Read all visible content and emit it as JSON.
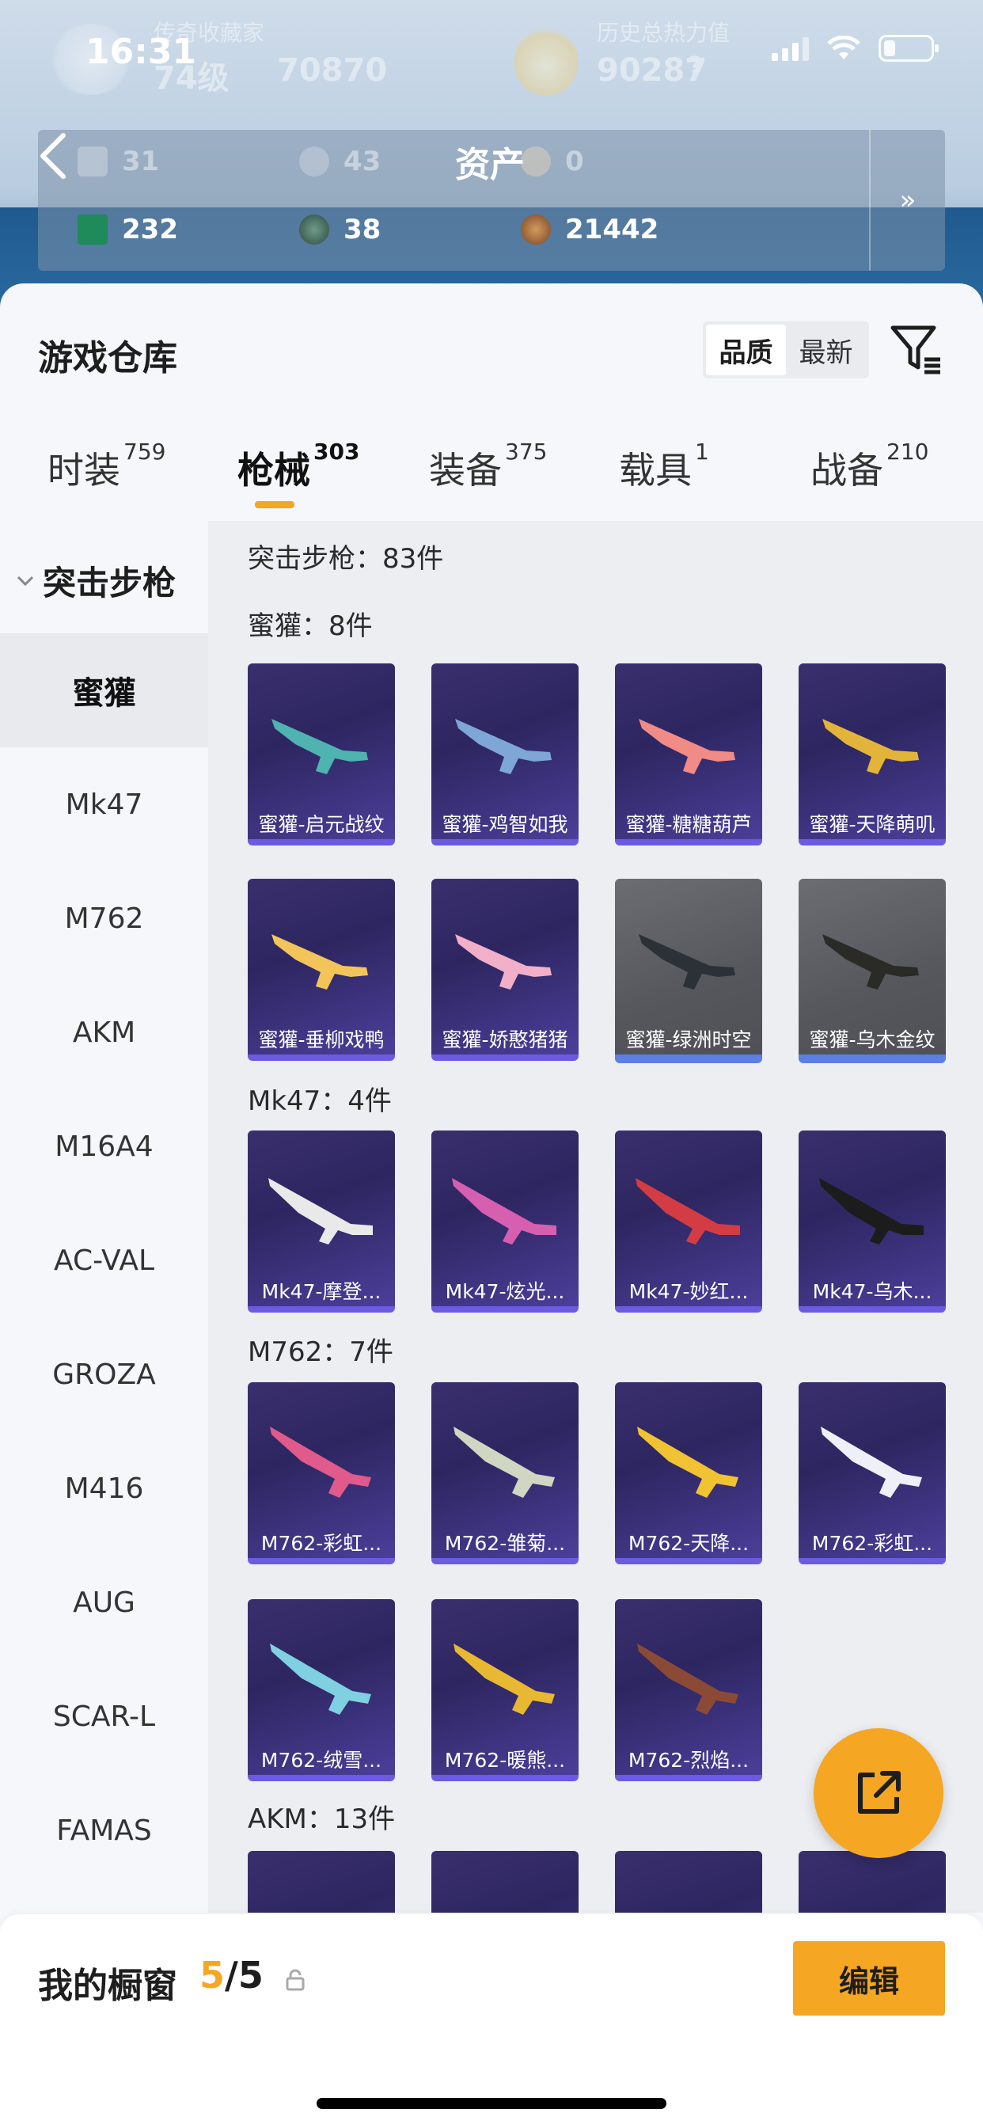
{
  "status_bar": {
    "time": "16:31"
  },
  "header": {
    "collector_label": "传奇收藏家",
    "level": "74级",
    "collector_points": "70870",
    "history_power_label": "历史总热力值",
    "history_power": "90287",
    "help_mark": "?",
    "assets_title": "资产",
    "assets_row1": [
      "31",
      "43",
      "0"
    ],
    "assets_row2": [
      "232",
      "38",
      "21442"
    ],
    "more": "»"
  },
  "warehouse": {
    "title": "游戏仓库",
    "sort": {
      "quality": "品质",
      "newest": "最新"
    }
  },
  "tabs": [
    {
      "label": "时装",
      "count": "759"
    },
    {
      "label": "枪械",
      "count": "303"
    },
    {
      "label": "装备",
      "count": "375"
    },
    {
      "label": "载具",
      "count": "1"
    },
    {
      "label": "战备",
      "count": "210"
    }
  ],
  "sidebar": {
    "category": "突击步枪",
    "items": [
      "蜜獾",
      "Mk47",
      "M762",
      "AKM",
      "M16A4",
      "AC-VAL",
      "GROZA",
      "M416",
      "AUG",
      "SCAR-L",
      "FAMAS"
    ]
  },
  "content": {
    "category_summary": "突击步枪：83件",
    "sections": [
      {
        "title": "蜜獾：8件",
        "items": [
          "蜜獾-启元战纹",
          "蜜獾-鸡智如我",
          "蜜獾-糖糖葫芦",
          "蜜獾-天降萌叽",
          "蜜獾-垂柳戏鸭",
          "蜜獾-娇憨猪猪",
          "蜜獾-绿洲时空",
          "蜜獾-乌木金纹"
        ]
      },
      {
        "title": "Mk47：4件",
        "items": [
          "Mk47-摩登...",
          "Mk47-炫光...",
          "Mk47-妙红...",
          "Mk47-乌木..."
        ]
      },
      {
        "title": "M762：7件",
        "items": [
          "M762-彩虹...",
          "M762-雏菊...",
          "M762-天降...",
          "M762-彩虹...",
          "M762-绒雪...",
          "M762-暖熊...",
          "M762-烈焰..."
        ]
      },
      {
        "title": "AKM：13件"
      }
    ]
  },
  "bottom": {
    "window_label": "我的橱窗",
    "window_used": "5",
    "window_total": "/5",
    "edit": "编辑"
  },
  "colors": {
    "accent": "#f5a623",
    "card_purple": "#2d2660",
    "card_gray": "#5a5c62"
  }
}
